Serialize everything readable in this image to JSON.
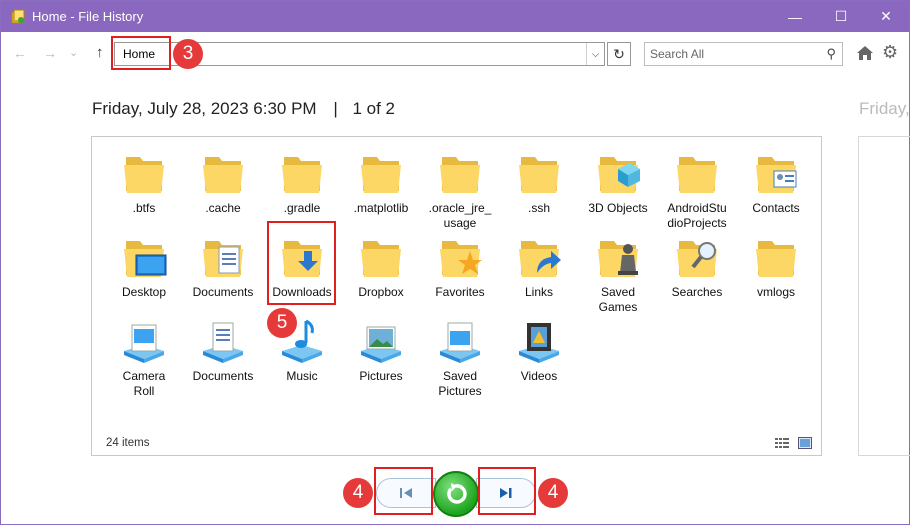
{
  "window": {
    "title": "Home - File History",
    "controls": {
      "minimize": "—",
      "maximize": "☐",
      "close": "✕"
    }
  },
  "toolbar": {
    "back": "←",
    "forward": "→",
    "recent": "⌄",
    "up": "↑",
    "address": "Home",
    "address_dropdown": "⌵",
    "refresh": "↻",
    "search_placeholder": "Search All",
    "search_icon": "⚲",
    "gear": "⚙"
  },
  "snapshot": {
    "date": "Friday, July 28, 2023 6:30 PM",
    "separator": "|",
    "page": "1 of 2",
    "next_date_fragment": "Friday,"
  },
  "items": [
    {
      "label": "\n.btfs",
      "icon": "folder"
    },
    {
      "label": "\n.cache",
      "icon": "folder"
    },
    {
      "label": "\n.gradle",
      "icon": "folder"
    },
    {
      "label": "\n.matplotlib",
      "icon": "folder"
    },
    {
      "label": ".oracle_jre_\nusage",
      "icon": "folder"
    },
    {
      "label": "\n.ssh",
      "icon": "folder"
    },
    {
      "label": "3D Objects",
      "icon": "folder-3d"
    },
    {
      "label": "AndroidStu\ndioProjects",
      "icon": "folder"
    },
    {
      "label": "Contacts",
      "icon": "folder-contacts"
    },
    {
      "label": "Desktop",
      "icon": "folder-desktop"
    },
    {
      "label": "Documents",
      "icon": "folder-documents"
    },
    {
      "label": "Downloads",
      "icon": "folder-downloads"
    },
    {
      "label": "Dropbox",
      "icon": "folder"
    },
    {
      "label": "Favorites",
      "icon": "folder-favorites"
    },
    {
      "label": "Links",
      "icon": "folder-links"
    },
    {
      "label": "Saved\nGames",
      "icon": "folder-games"
    },
    {
      "label": "Searches",
      "icon": "folder-searches"
    },
    {
      "label": "vmlogs",
      "icon": "folder"
    },
    {
      "label": "Camera\nRoll",
      "icon": "library-camera"
    },
    {
      "label": "Documents",
      "icon": "library-documents"
    },
    {
      "label": "Music",
      "icon": "library-music"
    },
    {
      "label": "Pictures",
      "icon": "library-pictures"
    },
    {
      "label": "Saved\nPictures",
      "icon": "library-saved-pictures"
    },
    {
      "label": "Videos",
      "icon": "library-videos"
    }
  ],
  "status": {
    "items_count": "24 items"
  },
  "annotations": {
    "badge_address": "3",
    "badge_prev": "4",
    "badge_next": "4",
    "badge_downloads": "5",
    "color": "#e63a3a"
  }
}
